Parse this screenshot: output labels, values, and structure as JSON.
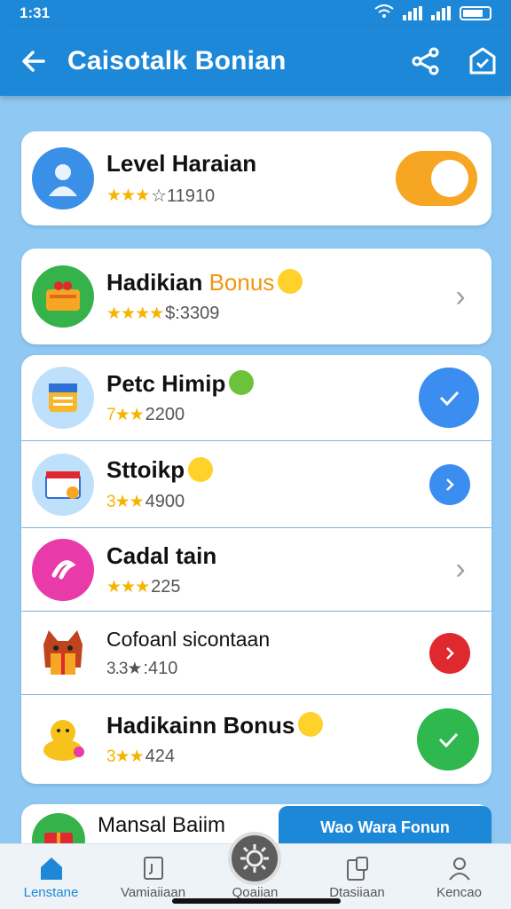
{
  "status": {
    "time": "1:31"
  },
  "appbar": {
    "title": "Caisotalk Bonian"
  },
  "items": [
    {
      "title": "Level Haraian",
      "accent": "",
      "stars": "★★★",
      "meta": "☆11910",
      "control": "toggle"
    },
    {
      "title": "Hadikian ",
      "accent": "Bonus",
      "stars": "★★★★",
      "meta": "$:3309",
      "control": "chevron"
    },
    {
      "title": "Petc Himip",
      "accent": "",
      "stars": "7★★",
      "meta": "2200",
      "control": "check-blue"
    },
    {
      "title": "Sttoikp",
      "accent": "",
      "stars": "3★★",
      "meta": "4900",
      "control": "chevron-blue"
    },
    {
      "title": "Cadal tain",
      "accent": "",
      "stars": "★★★",
      "meta": "225",
      "control": "chevron"
    },
    {
      "title": "Cofoanl sicontaan",
      "accent": "",
      "stars": "3.3★",
      "meta": ":410",
      "control": "chevron-red"
    },
    {
      "title": "Hadikainn Bonus",
      "accent": "",
      "stars": "3★★",
      "meta": "424",
      "control": "check-green"
    },
    {
      "title": "Mansal Baiim",
      "accent": "",
      "stars": "",
      "meta": "",
      "control": "none"
    }
  ],
  "banner": {
    "label": "Wao Wara Fonun"
  },
  "nav": [
    {
      "label": "Lenstane",
      "icon": "home-icon"
    },
    {
      "label": "Vamiaiiaan",
      "icon": "document-icon"
    },
    {
      "label": "Qoaiian",
      "icon": "gear-icon"
    },
    {
      "label": "Dtasiiaan",
      "icon": "device-icon"
    },
    {
      "label": "Kencao",
      "icon": "user-icon"
    }
  ],
  "colors": {
    "primary": "#1e88d8",
    "background": "#8fc9f3",
    "toggle": "#f6a623",
    "check_blue": "#3b8df0",
    "check_green": "#2eb84d",
    "alert_red": "#e0282f"
  }
}
